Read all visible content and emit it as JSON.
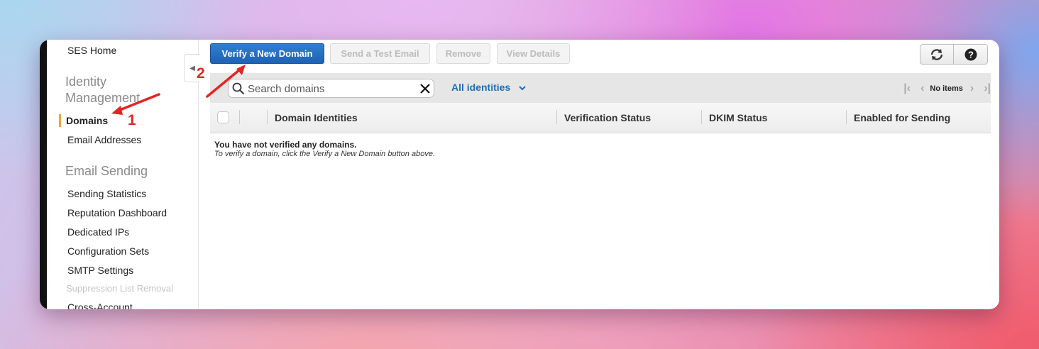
{
  "sidebar": {
    "home": "SES Home",
    "identity_header": "Identity Management",
    "domains": "Domains",
    "email_addresses": "Email Addresses",
    "sending_header": "Email Sending",
    "items": [
      "Sending Statistics",
      "Reputation Dashboard",
      "Dedicated IPs",
      "Configuration Sets",
      "SMTP Settings"
    ],
    "suppression": "Suppression List Removal",
    "cross_account": "Cross-Account"
  },
  "toolbar": {
    "verify_label": "Verify a New Domain",
    "send_test_label": "Send a Test Email",
    "remove_label": "Remove",
    "view_details_label": "View Details"
  },
  "search": {
    "placeholder": "Search domains",
    "filter_label": "All identities"
  },
  "pager": {
    "text": "No items"
  },
  "table": {
    "columns": [
      "Domain Identities",
      "Verification Status",
      "DKIM Status",
      "Enabled for Sending"
    ]
  },
  "empty": {
    "title": "You have not verified any domains.",
    "hint": "To verify a domain, click the Verify a New Domain button above."
  },
  "annotations": {
    "step1": "1",
    "step2": "2"
  },
  "colors": {
    "accent": "#1e62b4",
    "annotation": "#e42424",
    "active_marker": "#f0a733"
  }
}
